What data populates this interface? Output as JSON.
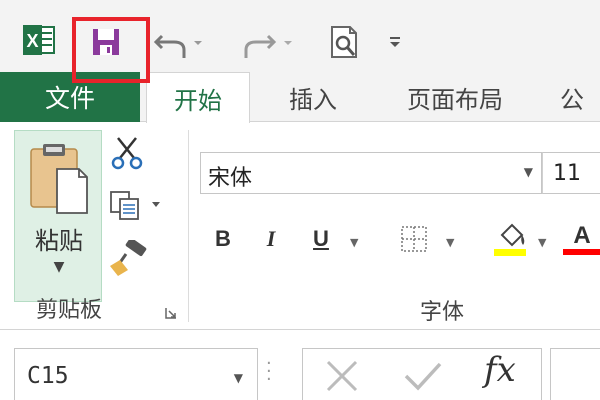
{
  "qat": {
    "app_logo": "excel-logo-icon",
    "save": "save-icon",
    "undo": "undo-icon",
    "redo": "redo-icon",
    "print_preview": "print-preview-icon",
    "customize": "customize-qat-icon",
    "highlight_color": "#e8232b"
  },
  "tabs": {
    "file": "文件",
    "home": "开始",
    "insert": "插入",
    "page_layout": "页面布局",
    "formulas": "公"
  },
  "clipboard": {
    "paste_label": "粘贴",
    "group_label": "剪贴板"
  },
  "font": {
    "name": "宋体",
    "size": "11",
    "bold": "B",
    "italic": "I",
    "underline": "U",
    "font_color_letter": "A",
    "group_label": "字体",
    "fill_color": "#ffff00",
    "text_color": "#ff0000"
  },
  "formula_bar": {
    "name_box": "C15",
    "fx": "fx"
  },
  "colors": {
    "accent": "#217346",
    "ribbon_bg": "#f3f3f3"
  }
}
